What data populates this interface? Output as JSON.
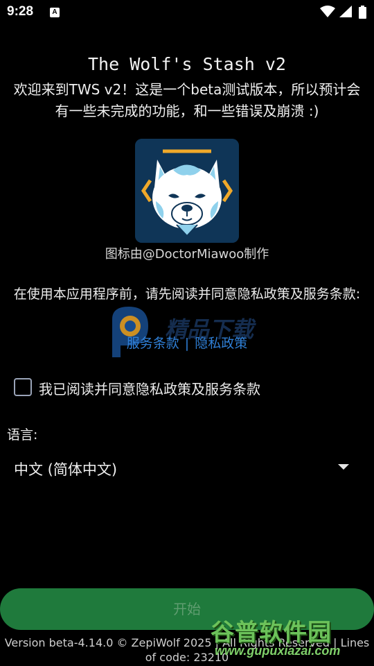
{
  "status_bar": {
    "time": "9:28",
    "notification_icon": "A",
    "icons": [
      "wifi-icon",
      "signal-icon",
      "battery-icon"
    ]
  },
  "app": {
    "title": "The Wolf's Stash v2",
    "welcome": "欢迎来到TWS v2！这是一个beta测试版本，所以预计会有一些未完成的功能，和一些错误及崩溃 :)",
    "icon_credit": "图标由@DoctorMiawoo制作",
    "privacy_prompt": "在使用本应用程序前，请先阅读并同意隐私政策及服务条款:",
    "terms_link": "服务条款",
    "link_separator": "|",
    "privacy_link": "隐私政策"
  },
  "agreement": {
    "label": "我已阅读并同意隐私政策及服务条款",
    "checked": false
  },
  "language": {
    "label": "语言:",
    "selected": "中文 (简体中文)"
  },
  "start_button": {
    "label": "开始",
    "enabled": false
  },
  "footer": {
    "version": "Version beta-4.14.0 © ZepiWolf 2025 | All Rights Reserved | Lines of code: 23210"
  },
  "watermarks": {
    "center_text": "精品下载",
    "corner_main": "谷普软件园",
    "corner_url": "www.gupuxiazai.com"
  },
  "colors": {
    "background": "#000000",
    "link": "#2f7fd6",
    "button": "#1f7a3c",
    "logo_bg": "#0f3557"
  }
}
